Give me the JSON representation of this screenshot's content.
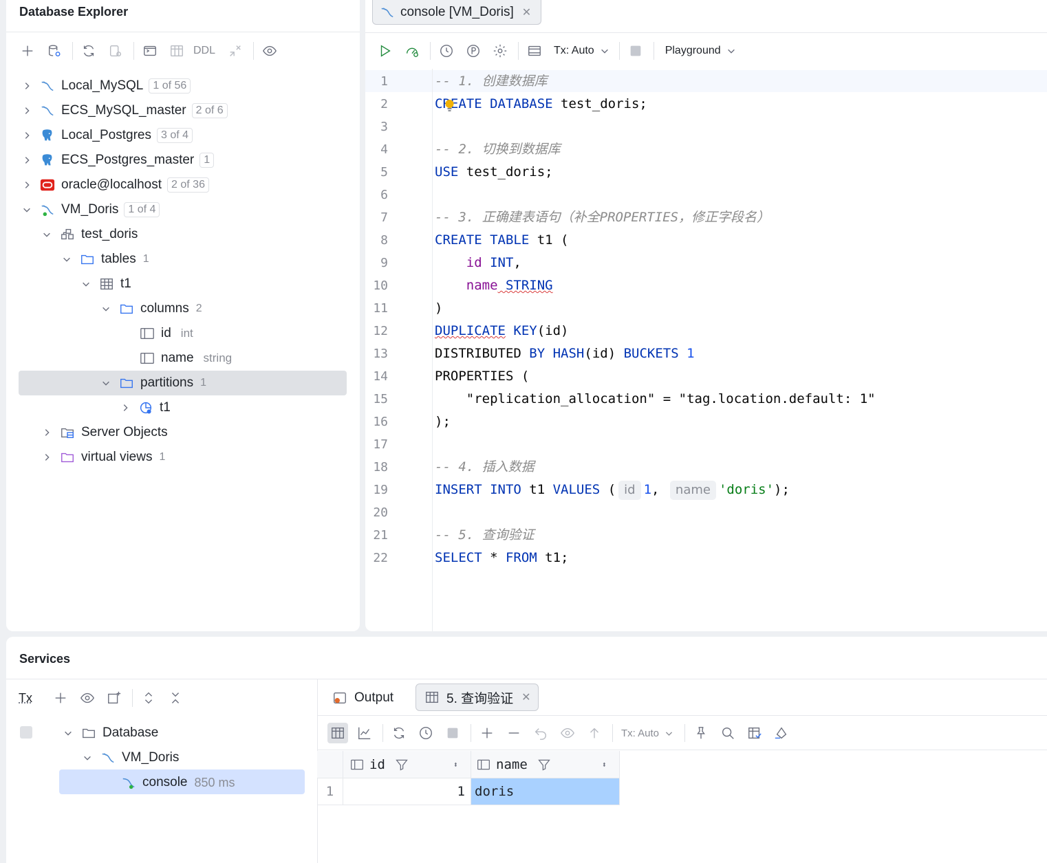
{
  "explorer": {
    "title": "Database Explorer",
    "toolbar": {
      "ddl_label": "DDL"
    },
    "connections": [
      {
        "name": "Local_MySQL",
        "badge": "1 of 56"
      },
      {
        "name": "ECS_MySQL_master",
        "badge": "2 of 6"
      },
      {
        "name": "Local_Postgres",
        "badge": "3 of 4"
      },
      {
        "name": "ECS_Postgres_master",
        "badge": "1"
      },
      {
        "name": "oracle@localhost",
        "badge": "2 of 36"
      },
      {
        "name": "VM_Doris",
        "badge": "1 of 4"
      }
    ],
    "tree": {
      "schema": "test_doris",
      "tables_label": "tables",
      "tables_count": "1",
      "table": "t1",
      "columns_label": "columns",
      "columns_count": "2",
      "columns": [
        {
          "name": "id",
          "type": "int"
        },
        {
          "name": "name",
          "type": "string"
        }
      ],
      "partitions_label": "partitions",
      "partitions_count": "1",
      "partition": "t1",
      "server_objects": "Server Objects",
      "virtual_views": "virtual views",
      "virtual_views_count": "1"
    }
  },
  "editor": {
    "tab_label": "console [VM_Doris]",
    "toolbar": {
      "tx_label": "Tx: Auto",
      "playground_label": "Playground"
    },
    "line_numbers": [
      "1",
      "2",
      "3",
      "4",
      "5",
      "6",
      "7",
      "8",
      "9",
      "10",
      "11",
      "12",
      "13",
      "14",
      "15",
      "16",
      "17",
      "18",
      "19",
      "20",
      "21",
      "22"
    ],
    "code": {
      "l1": "-- 1. 创建数据库",
      "l2a": "CREATE DATABASE",
      "l2b": " test_doris;",
      "l4": "-- 2. 切换到数据库",
      "l5a": "USE",
      "l5b": " test_doris;",
      "l7": "-- 3. 正确建表语句（补全PROPERTIES，修正字段名）",
      "l8a": "CREATE TABLE",
      "l8b": " t1 (",
      "l9a": "    id",
      "l9b": " INT",
      "l9c": ",",
      "l10a": "    name",
      "l10b": " STRING",
      "l11": ")",
      "l12a": "DUPLICATE",
      "l12b": " KEY",
      "l12c": "(id)",
      "l13a": "DISTRIBUTED",
      "l13b": " BY",
      "l13c": " HASH",
      "l13d": "(id) ",
      "l13e": "BUCKETS",
      "l13f": " 1",
      "l14": "PROPERTIES (",
      "l15a": "    \"replication_allocation\"",
      "l15b": " = ",
      "l15c": "\"tag.location.default: 1\"",
      "l16": ");",
      "l18": "-- 4. 插入数据",
      "l19a": "INSERT INTO",
      "l19b": " t1 ",
      "l19c": "VALUES",
      "l19d": " (",
      "l19_hint_id": "id",
      "l19e": "1",
      "l19f": ", ",
      "l19_hint_name": "name",
      "l19g": "'doris'",
      "l19h": ");",
      "l21": "-- 5. 查询验证",
      "l22a": "SELECT",
      "l22b": " * ",
      "l22c": "FROM",
      "l22d": " t1;"
    }
  },
  "services": {
    "title": "Services",
    "tx_label": "Tx",
    "tree": {
      "database": "Database",
      "connection": "VM_Doris",
      "console": "console",
      "console_time": "850 ms"
    },
    "tabs": {
      "output": "Output",
      "result": "5. 查询验证"
    },
    "result_toolbar": {
      "tx_label": "Tx: Auto"
    },
    "result": {
      "columns": [
        "id",
        "name"
      ],
      "rows": [
        {
          "num": "1",
          "id": "1",
          "name": "doris"
        }
      ]
    }
  }
}
